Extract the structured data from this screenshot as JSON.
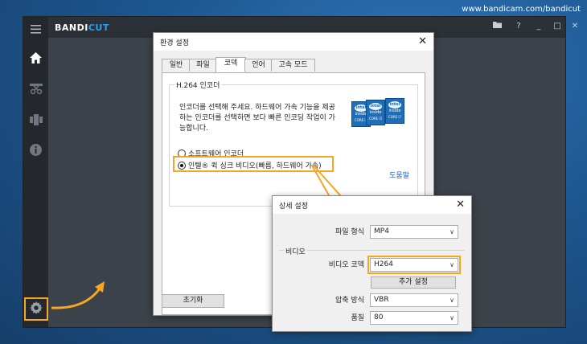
{
  "site_url": "www.bandicam.com/bandicut",
  "app": {
    "logo_main": "BANDI",
    "logo_accent": "CUT",
    "titlebar_buttons": [
      "folder",
      "?",
      "_",
      "□",
      "✕"
    ],
    "accent_color": "#f5a623"
  },
  "sidebar": {
    "items": [
      "menu",
      "home",
      "cut",
      "join",
      "info"
    ],
    "settings": "settings"
  },
  "settings_dialog": {
    "title": "환경 설정",
    "close": "✕",
    "tabs": [
      "일반",
      "파일",
      "코덱",
      "언어",
      "고속 모드"
    ],
    "active_tab": "코덱",
    "group_title": "H.264 인코더",
    "description": "인코더를 선택해 주세요. 하드웨어 가속 기능을 제공하는 인코더를 선택하면 보다 빠른 인코딩 작업이 가능합니다.",
    "options": [
      {
        "label": "소프트웨어 인코더",
        "selected": false
      },
      {
        "label": "인텔® 퀵 싱크 비디오(빠름, 하드웨어 가속)",
        "selected": true
      }
    ],
    "help_link": "도움말",
    "reset_button": "초기화",
    "chips": [
      {
        "brand": "intel",
        "sub": "inside",
        "core": "CORE i3"
      },
      {
        "brand": "intel",
        "sub": "inside",
        "core": "CORE i5"
      },
      {
        "brand": "intel",
        "sub": "inside",
        "core": "CORE i7"
      }
    ]
  },
  "advanced_dialog": {
    "title": "상세 설정",
    "close": "✕",
    "format_label": "파일 형식",
    "format_value": "MP4",
    "video_group": "비디오",
    "codec_label": "비디오 코덱",
    "codec_value": "H264",
    "extra_button": "추가 설정",
    "compression_label": "압축 방식",
    "compression_value": "VBR",
    "quality_label": "품질",
    "quality_value": "80"
  }
}
